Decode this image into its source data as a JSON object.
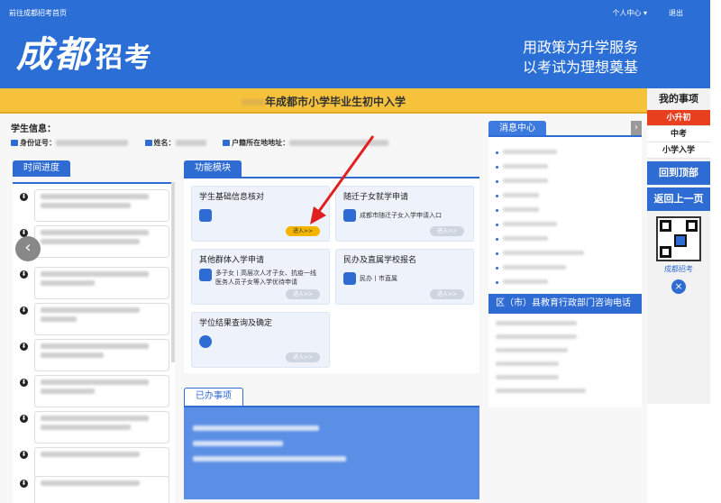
{
  "top": {
    "home_link": "前往成都招考首页",
    "user": "个人中心 ▾",
    "logout": "退出"
  },
  "logo": {
    "main": "成都",
    "sub": "招考"
  },
  "slogan": {
    "line1": "用政策为升学服务",
    "line2": "以考试为理想奠基"
  },
  "page_title": "年成都市小学毕业生初中入学",
  "student": {
    "label": "学生信息：",
    "id_label": "身份证号：",
    "name_label": "姓名：",
    "hukou_label": "户籍所在地地址："
  },
  "timeline": {
    "title": "时间进度"
  },
  "functions": {
    "title": "功能模块",
    "cards": [
      {
        "title": "学生基础信息核对",
        "desc": "",
        "button": "进入>>"
      },
      {
        "title": "随迁子女就学申请",
        "desc": "成都市随迁子女入学申请入口",
        "button": "进入>>"
      },
      {
        "title": "其他群体入学申请",
        "desc": "多子女丨高层次人才子女、抗疫一线医务人员子女等入学优待申请",
        "button": "进入>>"
      },
      {
        "title": "民办及直属学校报名",
        "desc": "民办丨市直属",
        "button": "进入>>"
      },
      {
        "title": "学位结果查询及确定",
        "desc": "",
        "button": "进入>>"
      }
    ]
  },
  "done": {
    "title": "已办事项"
  },
  "news": {
    "title": "消息中心"
  },
  "phones": {
    "title": "区（市）县教育行政部门咨询电话"
  },
  "sidebar": {
    "head": "我的事项",
    "items": [
      "小升初",
      "中考",
      "小学入学"
    ],
    "top_btn": "回到顶部",
    "back_btn": "返回上一页",
    "qr_label": "成都招考"
  }
}
